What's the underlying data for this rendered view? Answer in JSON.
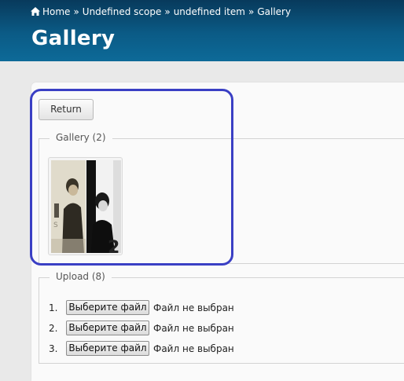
{
  "breadcrumb": {
    "items": [
      "Home",
      "Undefined scope",
      "undefined item",
      "Gallery"
    ],
    "separator": "»"
  },
  "page": {
    "title": "Gallery"
  },
  "return_button": {
    "label": "Return"
  },
  "gallery": {
    "legend": "Gallery (2)",
    "images": [
      {
        "name": "photo-thumbnail-1",
        "style": "sepia portrait"
      },
      {
        "name": "photo-thumbnail-2",
        "style": "black and white portrait"
      }
    ]
  },
  "upload": {
    "legend": "Upload (8)",
    "rows": [
      {
        "num": "1.",
        "button": "Выберите файл",
        "status": "Файл не выбран"
      },
      {
        "num": "2.",
        "button": "Выберите файл",
        "status": "Файл не выбран"
      },
      {
        "num": "3.",
        "button": "Выберите файл",
        "status": "Файл не выбран"
      }
    ]
  },
  "colors": {
    "header_top": "#083a5c",
    "header_bottom": "#0d6a98",
    "highlight": "#3a3fc4",
    "page_bg": "#e9e9e9"
  }
}
